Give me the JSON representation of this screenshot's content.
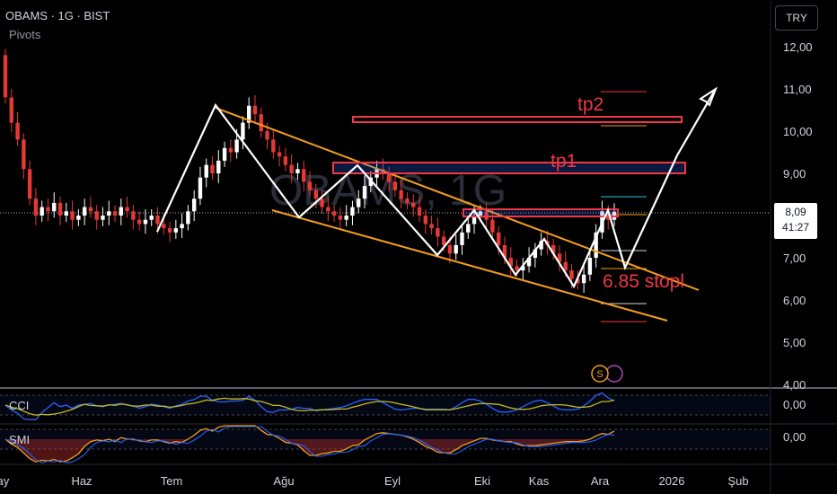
{
  "header": {
    "symbol_line": "OBAMS · 1G · BIST",
    "indicator": "Pivots",
    "watermark": "OBAMS, 1G",
    "currency_button": "TRY"
  },
  "price_tag": {
    "price": "8,09",
    "countdown": "41:27"
  },
  "annotations": {
    "tp1": "tp1",
    "tp2": "tp2",
    "stop": "6.85 stopl",
    "event_badge": "S"
  },
  "panes": {
    "cci_label": "CCI",
    "cci_value": "0,00",
    "smi_label": "SMI",
    "smi_value": "0,00"
  },
  "colors": {
    "up": "#ffffff",
    "down": "#e53935",
    "channel": "#f59d1b",
    "zone": "#f23645",
    "pattern": "#ffffff",
    "cci": "#2962ff",
    "cci_ma": "#c6b920",
    "smi": "#f59d1b",
    "smi_signal": "#2962ff"
  },
  "chart_data": {
    "type": "candlestick",
    "title": "OBAMS · 1G · BIST",
    "ylim": [
      4.0,
      12.4
    ],
    "y_ticks": [
      "12,00",
      "11,00",
      "10,00",
      "9,00",
      "8,00",
      "7,00",
      "6,00",
      "5,00",
      "4,00"
    ],
    "x_ticks": [
      "May",
      "Haz",
      "Tem",
      "Ağu",
      "Eyl",
      "Eki",
      "Kas",
      "Ara",
      "2026",
      "Şub"
    ],
    "last_price": 8.09,
    "levels": {
      "tp1": 9.1,
      "tp2": 10.3,
      "stop": 6.85
    },
    "closes": [
      10.8,
      10.2,
      9.8,
      9.1,
      8.4,
      8.0,
      8.2,
      8.1,
      8.3,
      8.0,
      8.1,
      7.9,
      8.0,
      8.2,
      8.1,
      7.9,
      8.0,
      8.1,
      8.0,
      8.2,
      8.1,
      7.9,
      7.8,
      7.9,
      8.0,
      7.8,
      7.7,
      7.6,
      7.7,
      7.8,
      8.1,
      8.4,
      8.9,
      9.2,
      9.0,
      9.3,
      9.6,
      9.5,
      9.8,
      10.2,
      10.6,
      10.4,
      10.0,
      9.8,
      9.5,
      9.4,
      9.2,
      9.0,
      9.1,
      8.8,
      8.6,
      8.4,
      8.2,
      8.1,
      8.0,
      7.9,
      8.0,
      8.2,
      8.4,
      8.7,
      8.9,
      9.1,
      9.0,
      8.8,
      8.6,
      8.4,
      8.3,
      8.2,
      8.0,
      7.8,
      7.7,
      7.5,
      7.3,
      7.1,
      7.3,
      7.6,
      7.8,
      8.0,
      8.1,
      7.9,
      7.6,
      7.3,
      7.0,
      6.8,
      6.7,
      6.8,
      7.0,
      7.2,
      7.4,
      7.3,
      7.1,
      6.9,
      6.7,
      6.5,
      6.4,
      6.6,
      7.0,
      7.6,
      8.1,
      7.9,
      8.09
    ]
  }
}
